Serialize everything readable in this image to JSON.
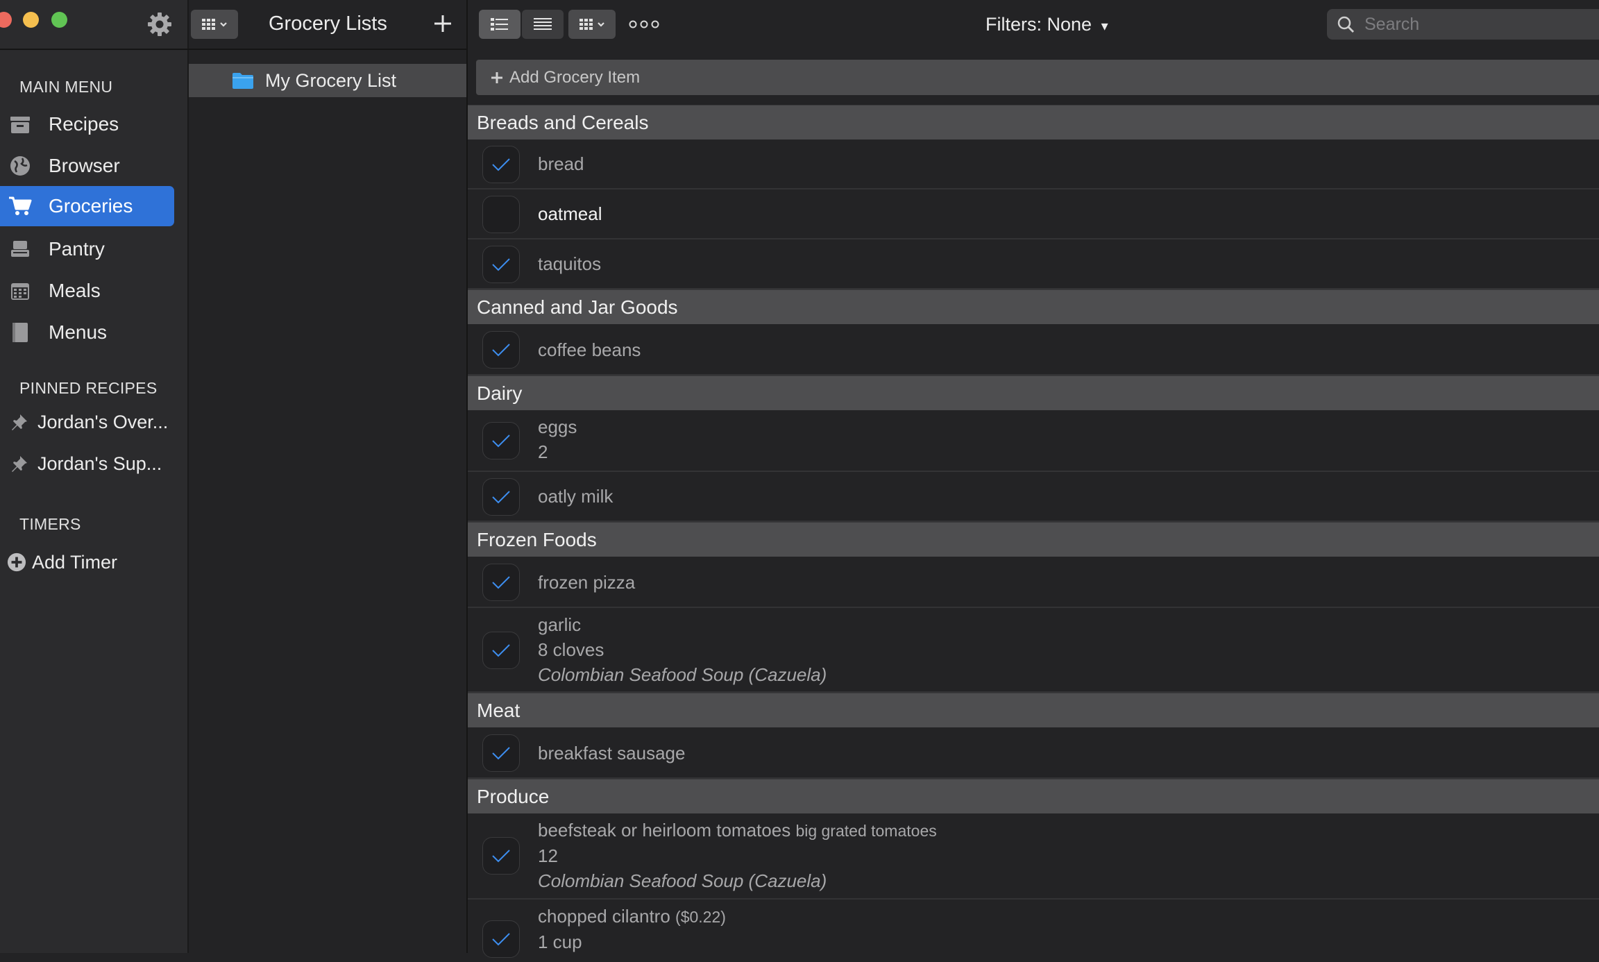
{
  "window": {
    "title": "Grocery Lists"
  },
  "sidebar": {
    "main_menu_title": "MAIN MENU",
    "items": [
      {
        "label": "Recipes",
        "icon": "recipe-box-icon"
      },
      {
        "label": "Browser",
        "icon": "globe-icon"
      },
      {
        "label": "Groceries",
        "icon": "cart-icon",
        "active": true
      },
      {
        "label": "Pantry",
        "icon": "pantry-icon"
      },
      {
        "label": "Meals",
        "icon": "calendar-icon"
      },
      {
        "label": "Menus",
        "icon": "book-icon"
      }
    ],
    "pinned_title": "PINNED RECIPES",
    "pinned": [
      {
        "label": "Jordan's Over..."
      },
      {
        "label": "Jordan's Sup..."
      }
    ],
    "timers_title": "TIMERS",
    "add_timer": "Add Timer"
  },
  "lists_panel": {
    "title": "Grocery Lists",
    "lists": [
      {
        "label": "My Grocery List",
        "icon": "folder-icon"
      }
    ]
  },
  "toolbar": {
    "filters_label": "Filters: None",
    "filters_arrow": "▾",
    "search_placeholder": "Search",
    "more_label": "ooo"
  },
  "main": {
    "add_item_label": "Add Grocery Item",
    "categories": [
      {
        "name": "Breads and Cereals",
        "items": [
          {
            "name": "bread",
            "checked": true
          },
          {
            "name": "oatmeal",
            "checked": false
          },
          {
            "name": "taquitos",
            "checked": true
          }
        ]
      },
      {
        "name": "Canned and Jar Goods",
        "items": [
          {
            "name": "coffee beans",
            "checked": true
          }
        ]
      },
      {
        "name": "Dairy",
        "items": [
          {
            "name": "eggs",
            "quantity": "2",
            "checked": true
          },
          {
            "name": "oatly milk",
            "checked": true
          }
        ]
      },
      {
        "name": "Frozen Foods",
        "items": [
          {
            "name": "frozen pizza",
            "checked": true
          },
          {
            "name": "garlic",
            "quantity": "8 cloves",
            "recipe": "Colombian Seafood Soup (Cazuela)",
            "checked": true
          }
        ]
      },
      {
        "name": "Meat",
        "items": [
          {
            "name": "breakfast sausage",
            "checked": true
          }
        ]
      },
      {
        "name": "Produce",
        "items": [
          {
            "name": "beefsteak or heirloom tomatoes",
            "note": "big grated tomatoes",
            "quantity": "12",
            "recipe": "Colombian Seafood Soup (Cazuela)",
            "checked": true
          },
          {
            "name": "chopped cilantro",
            "note": "($0.22)",
            "quantity": "1 cup",
            "checked": true
          }
        ]
      }
    ]
  },
  "colors": {
    "accent": "#2f72d8",
    "check": "#3d8ef0",
    "close": "#ed6a5e",
    "minimize": "#f5bf4f",
    "zoom": "#61c454"
  }
}
